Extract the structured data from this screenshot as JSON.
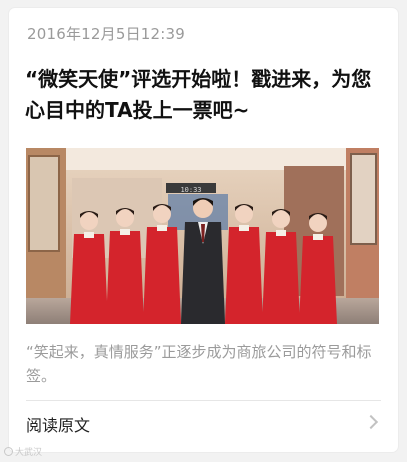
{
  "card": {
    "timestamp": "2016年12月5日12:39",
    "headline": "“微笑天使”评选开始啦！戳进来，为您心目中的TA投上一票吧~",
    "cover_image": {
      "clock_display": "10:33"
    },
    "summary": "“笑起来，真情服务”正逐步成为商旅公司的符号和标签。",
    "read_more_label": "阅读原文"
  },
  "colors": {
    "uniform_red": "#d4242c",
    "suit_dark": "#2a2a2e",
    "summary_gray": "#9b9b9b"
  },
  "watermark": {
    "text": "大武汉"
  }
}
